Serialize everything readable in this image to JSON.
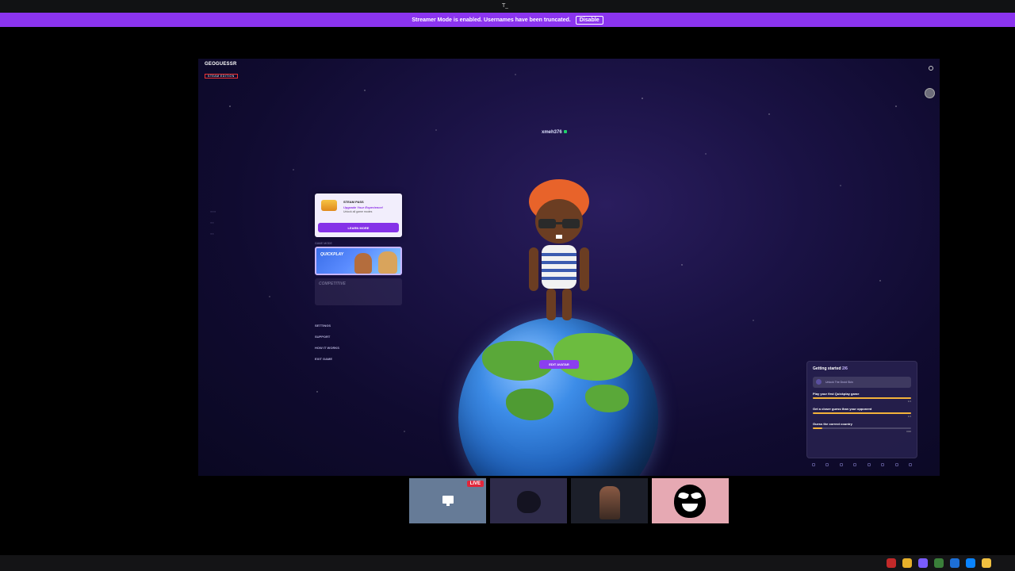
{
  "window": {
    "title": "T_"
  },
  "banner": {
    "message": "Streamer Mode is enabled. Usernames have been truncated.",
    "disable_label": "Disable"
  },
  "game": {
    "logo_line1": "GEOGUESSR",
    "logo_line2": "STEAM EDITION",
    "username": "xmeh376",
    "steam_pass": {
      "title": "STEAM PASS",
      "subtitle": "Upgrade Your Experience!",
      "description": "Unlock all game modes",
      "button": "LEARN MORE"
    },
    "game_mode_label": "GAME MODE",
    "modes": [
      {
        "label": "QUICKPLAY"
      },
      {
        "label": "COMPETITIVE"
      }
    ],
    "side_menu": [
      "SETTINGS",
      "SUPPORT",
      "HOW IT WORKS",
      "EXIT GAME"
    ],
    "edit_avatar": "EDIT AVATAR",
    "getting_started": {
      "title": "Getting started",
      "progress": "2/6",
      "reward": "Unlock The Droid Skin",
      "tasks": [
        {
          "label": "Play your first Quickplay game",
          "fill": 1.0,
          "count": "1/1"
        },
        {
          "label": "Get a closer guess than your opponent",
          "fill": 1.0,
          "count": "1/1"
        },
        {
          "label": "Guess the correct country",
          "fill": 0.1,
          "count": "0/20"
        }
      ]
    }
  },
  "participants": {
    "live_label": "LIVE"
  },
  "colors": {
    "banner": "#8b34ef",
    "accent": "#8532e8",
    "live": "#e2263a"
  }
}
